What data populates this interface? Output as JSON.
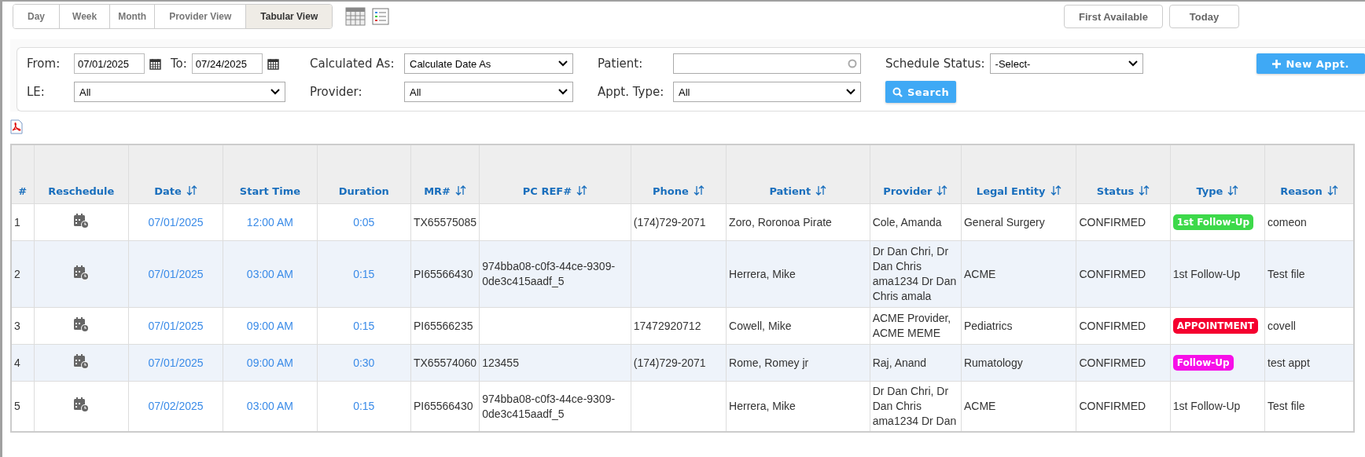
{
  "view_tabs": [
    {
      "label": "Day",
      "selected": false
    },
    {
      "label": "Week",
      "selected": false
    },
    {
      "label": "Month",
      "selected": false
    },
    {
      "label": "Provider View",
      "selected": false
    },
    {
      "label": "Tabular View",
      "selected": true
    }
  ],
  "top_buttons": [
    "First Available",
    "Today"
  ],
  "filters": {
    "from": {
      "label": "From:",
      "value": "07/01/2025"
    },
    "to": {
      "label": "To:",
      "value": "07/24/2025"
    },
    "calculated_as": {
      "label": "Calculated As:",
      "value": "Calculate Date As"
    },
    "patient": {
      "label": "Patient:"
    },
    "schedule_status": {
      "label": "Schedule Status:",
      "value": "-Select-"
    },
    "le": {
      "label": "LE:",
      "value": "All"
    },
    "provider": {
      "label": "Provider:",
      "value": "All"
    },
    "appt_type": {
      "label": "Appt. Type:",
      "value": "All"
    },
    "new_appt": "New Appt.",
    "search": "Search"
  },
  "table": {
    "columns": [
      {
        "label": "#",
        "sortable": false
      },
      {
        "label": "Reschedule",
        "sortable": false
      },
      {
        "label": "Date",
        "sortable": true
      },
      {
        "label": "Start Time",
        "sortable": false
      },
      {
        "label": "Duration",
        "sortable": false
      },
      {
        "label": "MR#",
        "sortable": true
      },
      {
        "label": "PC REF#",
        "sortable": true
      },
      {
        "label": "Phone",
        "sortable": true
      },
      {
        "label": "Patient",
        "sortable": true
      },
      {
        "label": "Provider",
        "sortable": true
      },
      {
        "label": "Legal Entity",
        "sortable": true
      },
      {
        "label": "Status",
        "sortable": true
      },
      {
        "label": "Type",
        "sortable": true
      },
      {
        "label": "Reason",
        "sortable": true
      }
    ],
    "rows": [
      {
        "num": "1",
        "date": "07/01/2025",
        "start_time": "12:00 AM",
        "duration": "0:05",
        "mr": "TX65575085",
        "pc_ref": "",
        "phone": "(174)729-2071",
        "patient": "Zoro, Roronoa Pirate",
        "provider": "Cole, Amanda",
        "legal_entity": "General Surgery",
        "status": "CONFIRMED",
        "type": {
          "text": "1st Follow-Up",
          "kind": "badge",
          "color": "#3dd94a"
        },
        "reason": "comeon"
      },
      {
        "num": "2",
        "date": "07/01/2025",
        "start_time": "03:00 AM",
        "duration": "0:15",
        "mr": "PI65566430",
        "pc_ref": "974bba08-c0f3-44ce-9309-0de3c415aadf_5",
        "phone": "",
        "patient": "Herrera, Mike",
        "provider": "Dr Dan Chri, Dr Dan Chris ama1234 Dr Dan Chris amala",
        "legal_entity": "ACME",
        "status": "CONFIRMED",
        "type": {
          "text": "1st Follow-Up",
          "kind": "plain"
        },
        "reason": "Test file"
      },
      {
        "num": "3",
        "date": "07/01/2025",
        "start_time": "09:00 AM",
        "duration": "0:15",
        "mr": "PI65566235",
        "pc_ref": "",
        "phone": "17472920712",
        "patient": "Cowell, Mike",
        "provider": "ACME Provider, ACME MEME",
        "legal_entity": "Pediatrics",
        "status": "CONFIRMED",
        "type": {
          "text": "APPOINTMENT",
          "kind": "badge",
          "color": "#f5002f"
        },
        "reason": "covell"
      },
      {
        "num": "4",
        "date": "07/01/2025",
        "start_time": "09:00 AM",
        "duration": "0:30",
        "mr": "TX65574060",
        "pc_ref": "123455",
        "phone": "(174)729-2071",
        "patient": "Rome, Romey jr",
        "provider": "Raj, Anand",
        "legal_entity": "Rumatology",
        "status": "CONFIRMED",
        "type": {
          "text": "Follow-Up",
          "kind": "badge",
          "color": "#f70fe8"
        },
        "reason": "test appt"
      },
      {
        "num": "5",
        "date": "07/02/2025",
        "start_time": "03:00 AM",
        "duration": "0:15",
        "mr": "PI65566430",
        "pc_ref": "974bba08-c0f3-44ce-9309-0de3c415aadf_5",
        "phone": "",
        "patient": "Herrera, Mike",
        "provider": "Dr Dan Chri, Dr Dan Chris ama1234 Dr Dan",
        "legal_entity": "ACME",
        "status": "CONFIRMED",
        "type": {
          "text": "1st Follow-Up",
          "kind": "plain"
        },
        "reason": "Test file"
      }
    ]
  }
}
